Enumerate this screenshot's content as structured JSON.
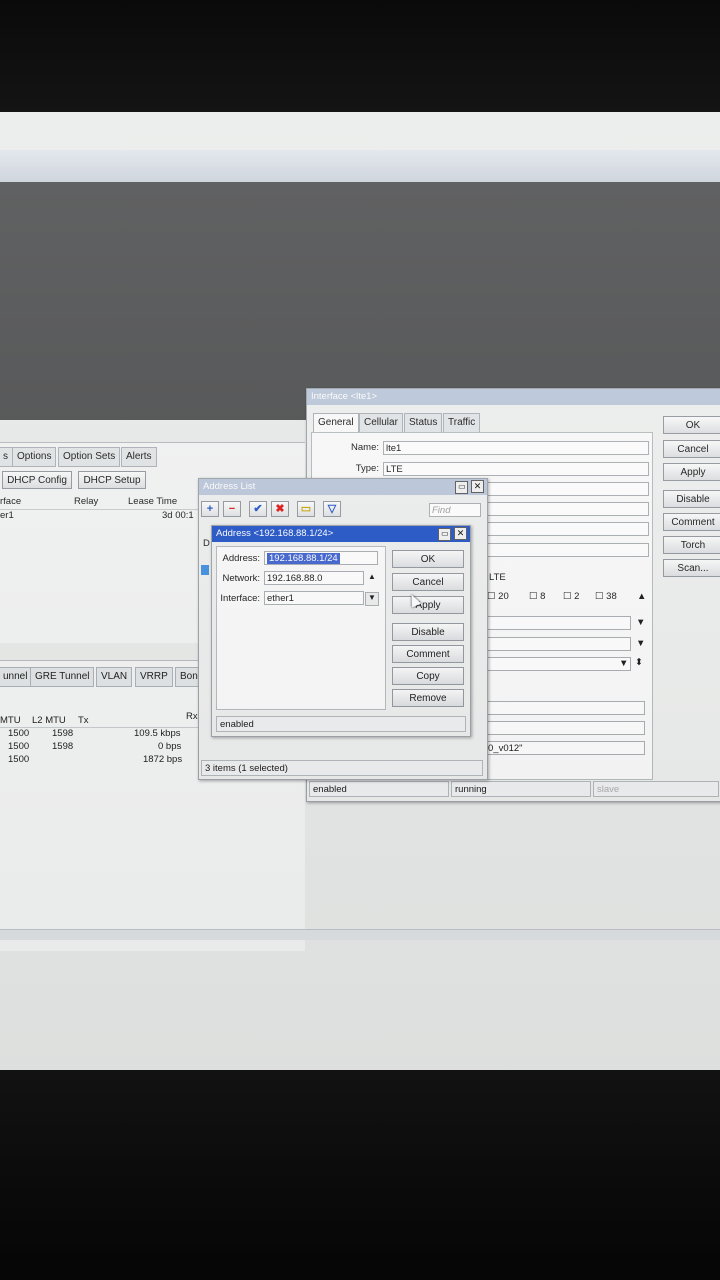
{
  "interface_window": {
    "title": "Interface <lte1>",
    "tabs": [
      "General",
      "Cellular",
      "Status",
      "Traffic"
    ],
    "name_label": "Name:",
    "name_value": "lte1",
    "type_label": "Type:",
    "type_value": "LTE",
    "buttons": [
      "OK",
      "Cancel",
      "Apply",
      "Disable",
      "Comment",
      "Torch",
      "Scan..."
    ],
    "partial_value": "LTE",
    "bands": [
      "20",
      "8",
      "2",
      "38"
    ],
    "partial_firmware": "0_v012\"",
    "status_enabled": "enabled",
    "status_running": "running",
    "status_slave": "slave"
  },
  "dhcp_panel": {
    "tabs": [
      "s",
      "Options",
      "Option Sets",
      "Alerts"
    ],
    "buttons": [
      "DHCP Config",
      "DHCP Setup"
    ],
    "columns": [
      "rface",
      "Relay",
      "Lease Time"
    ],
    "row": {
      "iface": "er1",
      "lease": "3d 00:1"
    }
  },
  "interfaces_panel": {
    "tabs": [
      "unnel",
      "GRE Tunnel",
      "VLAN",
      "VRRP",
      "Bon"
    ],
    "columns": [
      "MTU",
      "L2 MTU",
      "Tx",
      "Rx"
    ],
    "rows": [
      {
        "mtu": "1500",
        "l2mtu": "1598",
        "tx": "109.5 kbps"
      },
      {
        "mtu": "1500",
        "l2mtu": "1598",
        "tx": "0 bps"
      },
      {
        "mtu": "1500",
        "l2mtu": "",
        "tx": "1872 bps"
      }
    ]
  },
  "address_list": {
    "title": "Address List",
    "find_placeholder": "Find",
    "status": "3 items (1 selected)",
    "col_partial": "D"
  },
  "address_dialog": {
    "title": "Address <192.168.88.1/24>",
    "address_label": "Address:",
    "address_value": "192.168.88.1/24",
    "network_label": "Network:",
    "network_value": "192.168.88.0",
    "interface_label": "Interface:",
    "interface_value": "ether1",
    "buttons": {
      "ok": "OK",
      "cancel": "Cancel",
      "apply": "Apply",
      "disable": "Disable",
      "comment": "Comment",
      "copy": "Copy",
      "remove": "Remove"
    },
    "status": "enabled"
  },
  "colors": {
    "active_title": "#1b4fc7",
    "inactive_title": "#b9c6da",
    "selection": "#3a5fcf"
  }
}
